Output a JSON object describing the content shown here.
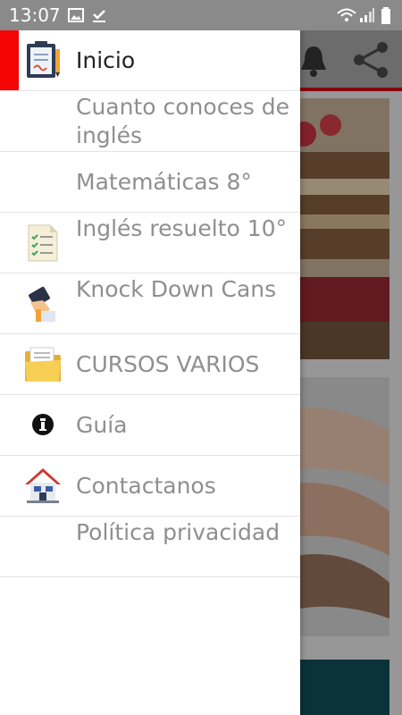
{
  "status_bar": {
    "time": "13:07"
  },
  "drawer": {
    "items": [
      {
        "label": "Inicio",
        "icon": "clipboard-icon",
        "active": true
      },
      {
        "label": "Cuanto conoces de inglés",
        "icon": ""
      },
      {
        "label": "Matemáticas 8°",
        "icon": ""
      },
      {
        "label": "Inglés resuelto 10°",
        "icon": "checklist-icon"
      },
      {
        "label": "Knock Down Cans",
        "icon": "tablet-hand-icon"
      },
      {
        "label": "CURSOS VARIOS",
        "icon": "folder-icon"
      },
      {
        "label": "Guía",
        "icon": "info-icon"
      },
      {
        "label": "Contactanos",
        "icon": "house-icon"
      },
      {
        "label": "Política privacidad",
        "icon": ""
      }
    ]
  },
  "colors": {
    "accent": "#f50505",
    "appbar_line": "#c00012"
  }
}
